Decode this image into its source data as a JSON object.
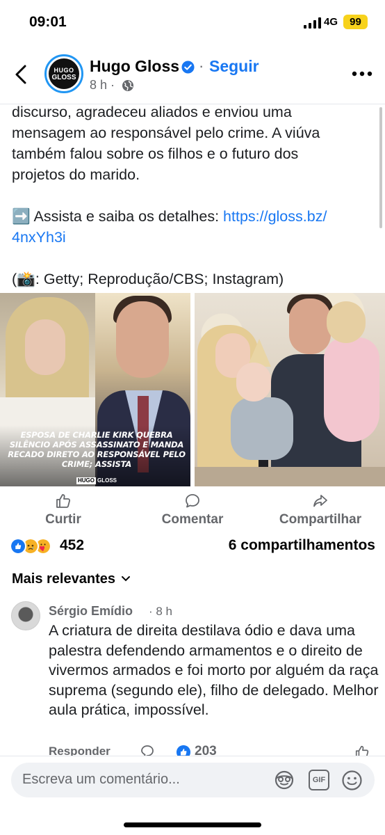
{
  "status_bar": {
    "time": "09:01",
    "network": "4G",
    "battery": "99",
    "battery_color": "#f7d21c"
  },
  "header": {
    "logo_line1": "HUGO",
    "logo_line2": "GLOSS",
    "page_name": "Hugo Gloss",
    "separator": "·",
    "follow_label": "Seguir",
    "time": "8 h ·",
    "icons": [
      "back-arrow-icon",
      "verified-badge-icon",
      "globe-icon",
      "more-icon"
    ]
  },
  "post": {
    "text_lines": [
      "discurso, agradeceu aliados e enviou uma",
      "mensagem ao responsável pelo crime. A viúva",
      "também falou sobre os filhos e o futuro dos",
      "projetos do marido."
    ],
    "watch_prefix": "➡️ Assista e saiba os detalhes: ",
    "link_line1": "https://gloss.bz/",
    "link_line2": "4nxYh3i",
    "credits": "(📸: Getty; Reprodução/CBS; Instagram)",
    "image_caption": "Esposa de Charlie Kirk quebra silêncio após assassinato e manda recado direto ao responsável pelo crime; assista",
    "watermark_a": "HUGO",
    "watermark_b": "GLOSS"
  },
  "actions": {
    "like": "Curtir",
    "comment": "Comentar",
    "share": "Compartilhar"
  },
  "reactions": {
    "count": "452",
    "shares": "6 compartilhamentos",
    "icons": [
      "like-reaction-icon",
      "sad-reaction-icon",
      "care-reaction-icon"
    ]
  },
  "sort": {
    "label": "Mais relevantes"
  },
  "comment": {
    "author": "Sérgio Emídio",
    "time": "· 8 h",
    "text": "A criatura de direita destilava ódio e dava uma palestra defendendo armamentos e o direito de vivermos armados e foi morto por alguém da raça suprema (segundo ele), filho de delegado. Melhor aula prática, impossível.",
    "reply": "Responder",
    "likes": "203"
  },
  "composer": {
    "placeholder": "Escreva um comentário...",
    "gif": "GIF"
  },
  "colors": {
    "accent": "#1877f2",
    "secondary_text": "#65676b",
    "verified": "#1877f2"
  }
}
